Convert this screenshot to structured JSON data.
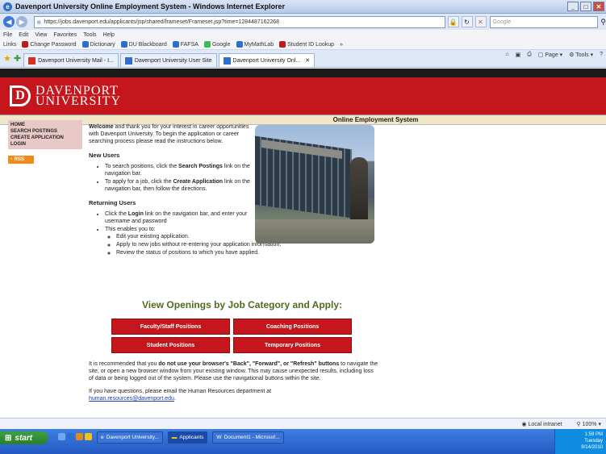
{
  "window": {
    "title": "Davenport University Online Employment System - Windows Internet Explorer"
  },
  "address": {
    "url": "https://jobs.davenport.edu/applicants/jsp/shared/frameset/Frameset.jsp?time=1284487162268",
    "search_placeholder": "Google"
  },
  "menu": [
    "File",
    "Edit",
    "View",
    "Favorites",
    "Tools",
    "Help"
  ],
  "links": {
    "label": "Links",
    "items": [
      "Change Password",
      "Dictionary",
      "DU Blackboard",
      "FAFSA",
      "Google",
      "MyMathLab",
      "Student ID Lookup"
    ]
  },
  "tabs": [
    {
      "label": "Davenport University Mail - I..."
    },
    {
      "label": "Davenport University User Site"
    },
    {
      "label": "Davenport University Onl..."
    }
  ],
  "commands": {
    "page": "Page",
    "tools": "Tools"
  },
  "site": {
    "brand_line1": "DAVENPORT",
    "brand_line2": "UNIVERSITY",
    "subheader": "Online Employment System",
    "nav": [
      "HOME",
      "SEARCH POSTINGS",
      "CREATE APPLICATION",
      "LOGIN"
    ],
    "rss": "RSS"
  },
  "content": {
    "welcome_bold": "Welcome",
    "welcome_rest": " and thank you for your interest in career opportunities with Davenport University. To begin the application or career searching process please read the instructions below.",
    "new_users_heading": "New Users",
    "new_users_1a": "To search positions, click the ",
    "new_users_1b": "Search Postings",
    "new_users_1c": " link on the navigation bar.",
    "new_users_2a": "To apply for a job, click the ",
    "new_users_2b": "Create Application",
    "new_users_2c": " link on the navigation bar, then follow the directions.",
    "returning_heading": "Returning Users",
    "ret_1a": "Click the ",
    "ret_1b": "Login",
    "ret_1c": " link on the navigation bar, and enter your username and password",
    "ret_2": "This enables you to:",
    "ret_sub": [
      "Edit your existing application.",
      "Apply to new jobs without re-entering your application information.",
      "Review the status of positions to which you have applied."
    ],
    "openings_title": "View Openings by Job Category and Apply:",
    "buttons": [
      "Faculty/Staff Positions",
      "Coaching Positions",
      "Student Positions",
      "Temporary Positions"
    ],
    "warn_a": "It is recommended that you ",
    "warn_b": "do not use your browser's \"Back\", \"Forward\", or \"Refresh\" buttons",
    "warn_c": " to navigate the site, or open a new browser window from your existing window. This may cause unexpected results, including loss of data or being logged out of the system. Please use the navigational buttons within the site.",
    "contact_a": "If you have questions, please email the Human Resources department at ",
    "contact_email": "human.resources@davenport.edu",
    "contact_c": "."
  },
  "status": {
    "zone": "Local intranet",
    "zoom": "100%"
  },
  "taskbar": {
    "start": "start",
    "tasks": [
      "Davenport University...",
      "Applicants",
      "Document1 - Microsof..."
    ],
    "time": "1:59 PM",
    "day": "Tuesday",
    "date": "9/14/2010"
  },
  "colors": {
    "brand_red": "#c4161c",
    "nav_pink": "#e9c8c8",
    "openings_green": "#4e6b1f"
  }
}
